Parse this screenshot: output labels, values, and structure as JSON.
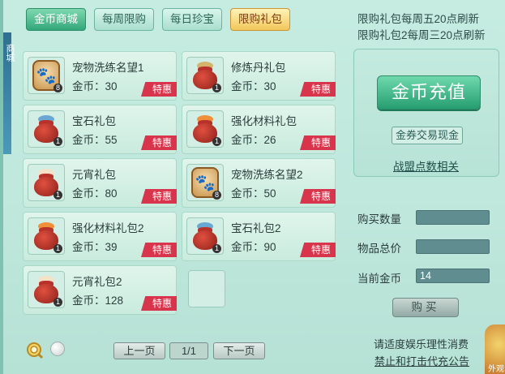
{
  "tabs": [
    {
      "label": "金币商城",
      "style": "green"
    },
    {
      "label": "每周限购",
      "style": "normal"
    },
    {
      "label": "每日珍宝",
      "style": "normal"
    },
    {
      "label": "限购礼包",
      "style": "active"
    }
  ],
  "notice": {
    "line1": "限购礼包每周五20点刷新",
    "line2": "限购礼包2每周三20点刷新"
  },
  "items": [
    {
      "name": "宠物洗练名望1",
      "price": "金币：30",
      "qty": "8",
      "tag": "特惠",
      "icon": "paw-plaque-icon"
    },
    {
      "name": "修炼丹礼包",
      "price": "金币：30",
      "qty": "1",
      "tag": "特惠",
      "icon": "gift-bag-icon"
    },
    {
      "name": "宝石礼包",
      "price": "金币：55",
      "qty": "1",
      "tag": "特惠",
      "icon": "gift-bag-icon"
    },
    {
      "name": "强化材料礼包",
      "price": "金币：26",
      "qty": "1",
      "tag": "特惠",
      "icon": "gift-bag-icon"
    },
    {
      "name": "元宵礼包",
      "price": "金币：80",
      "qty": "1",
      "tag": "特惠",
      "icon": "gift-bag-icon"
    },
    {
      "name": "宠物洗练名望2",
      "price": "金币：50",
      "qty": "8",
      "tag": "特惠",
      "icon": "paw-plaque-icon"
    },
    {
      "name": "强化材料礼包2",
      "price": "金币：39",
      "qty": "1",
      "tag": "特惠",
      "icon": "gift-bag-icon"
    },
    {
      "name": "宝石礼包2",
      "price": "金币：90",
      "qty": "1",
      "tag": "特惠",
      "icon": "gift-bag-icon"
    },
    {
      "name": "元宵礼包2",
      "price": "金币：128",
      "qty": "1",
      "tag": "特惠",
      "icon": "gift-bag-icon"
    }
  ],
  "panel": {
    "recharge_label": "金币充值",
    "exchange_label": "金券交易现金",
    "alliance_label": "战盟点数相关"
  },
  "purchase": {
    "qty_label": "购买数量",
    "qty_value": "",
    "total_label": "物品总价",
    "total_value": "",
    "gold_label": "当前金币",
    "gold_value": "14",
    "buy_label": "购买"
  },
  "footer": {
    "note": "请适度娱乐理性消费",
    "link": "禁止和打击代充公告"
  },
  "pager": {
    "prev": "上一页",
    "page": "1/1",
    "next": "下一页"
  },
  "side": {
    "left_text": "商城",
    "corner_text": "外观"
  },
  "colors": {
    "bg": "#c6ece1",
    "tag_red": "#d8344b",
    "accent_green": "#269e71",
    "active_tab_gold": "#f2c75b"
  }
}
